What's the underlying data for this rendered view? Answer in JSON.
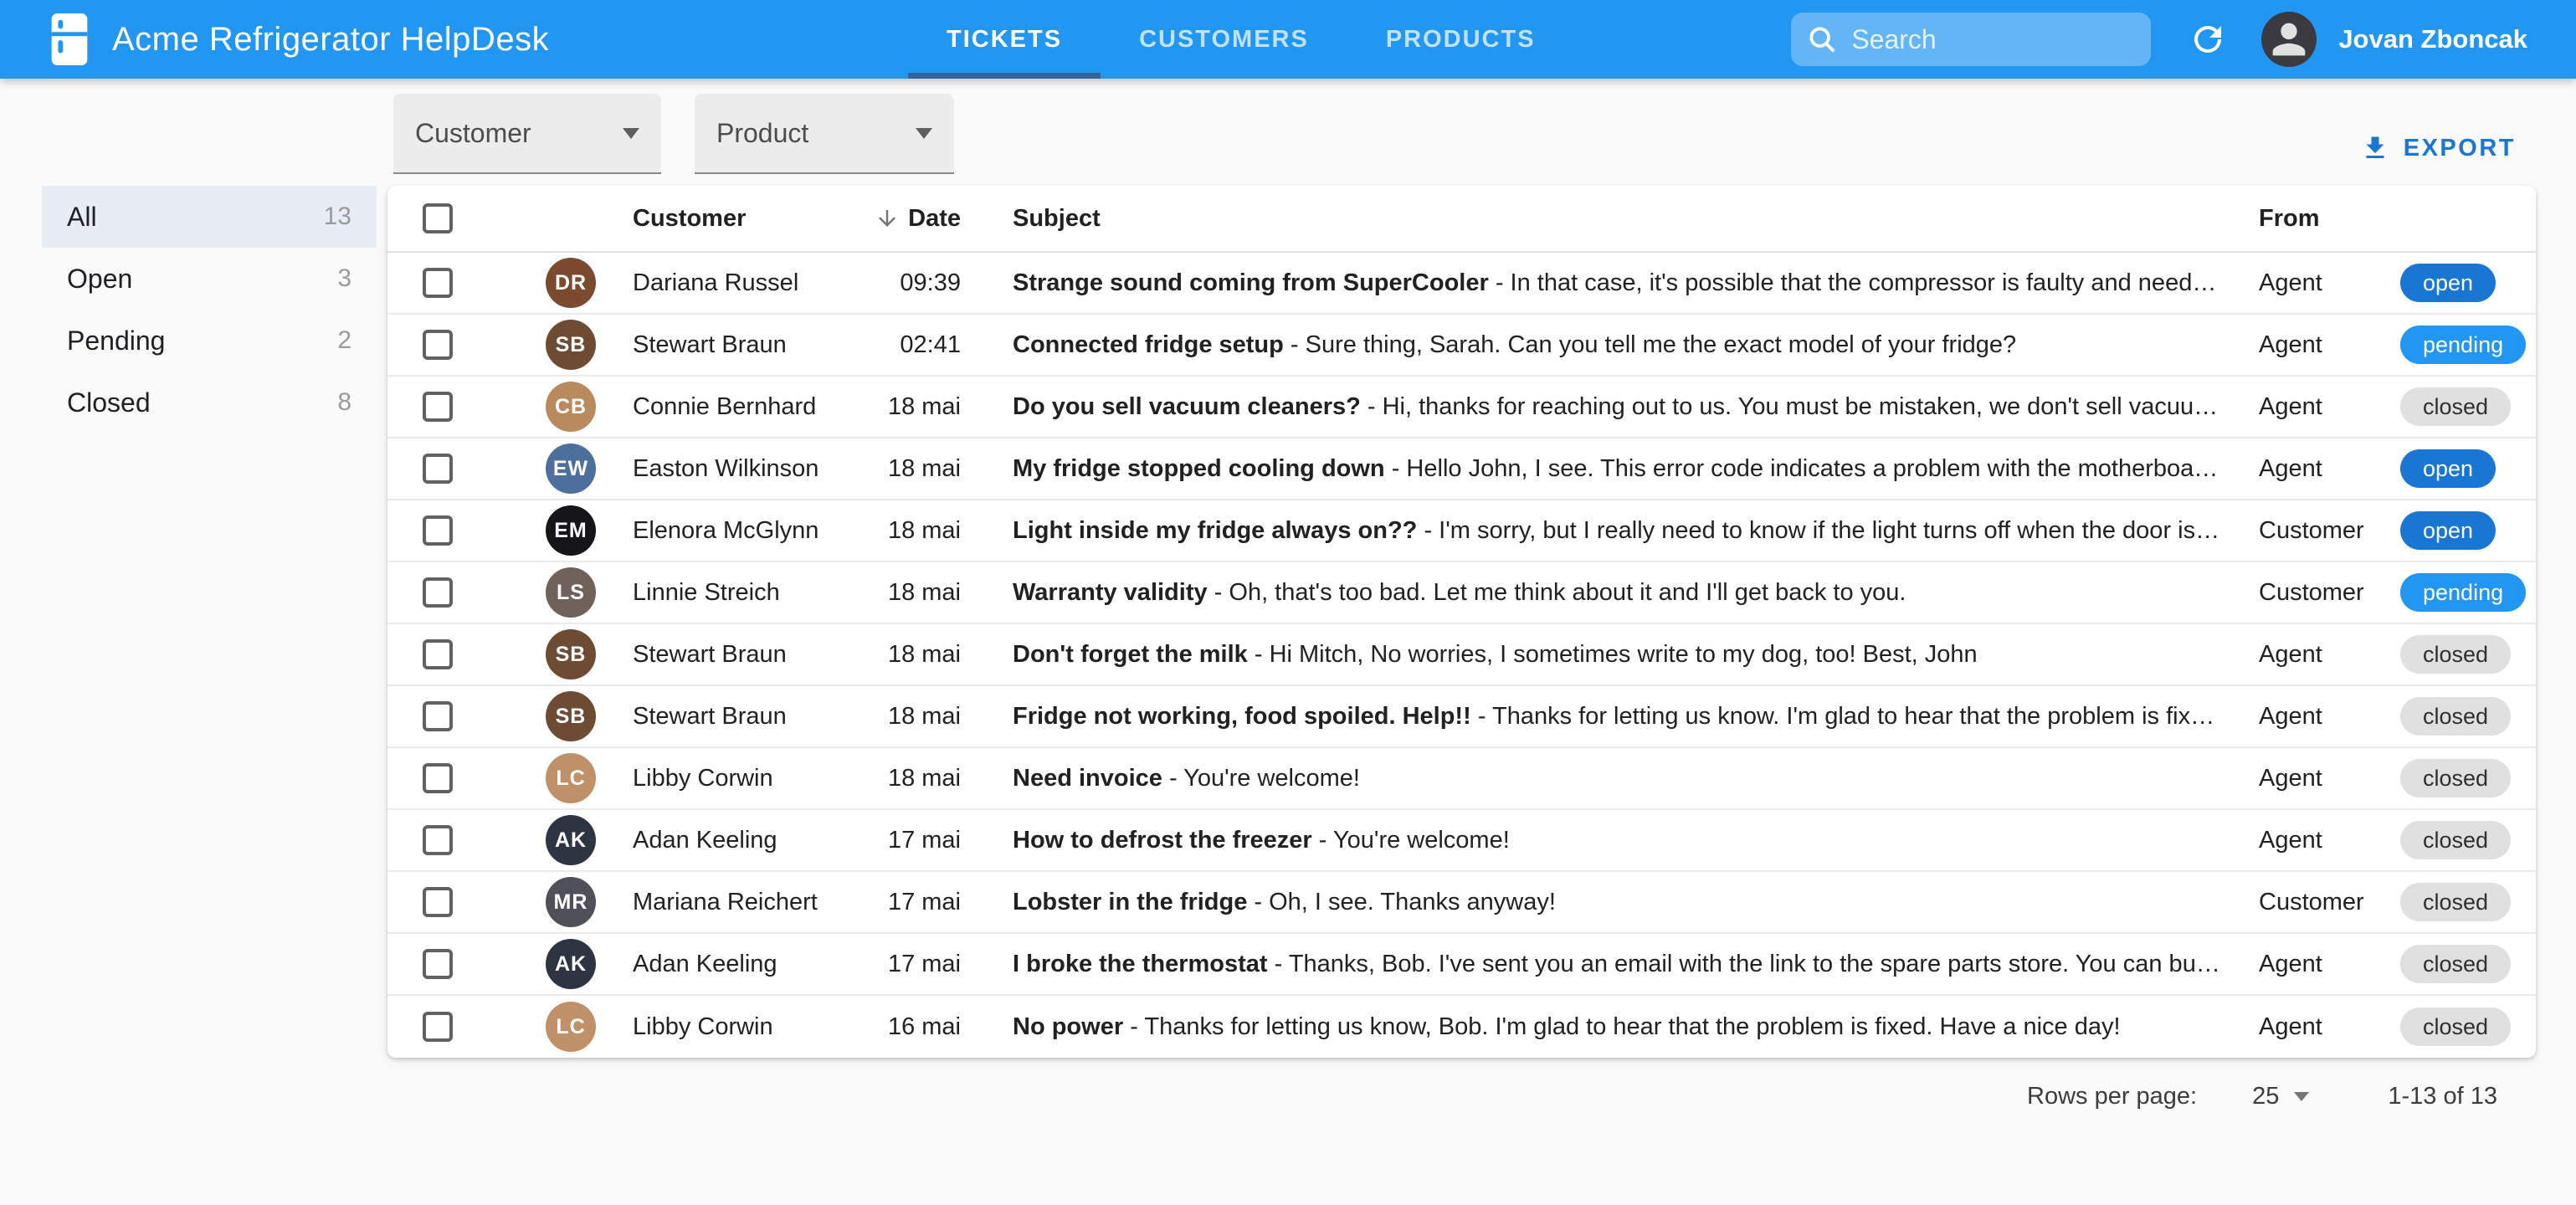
{
  "app": {
    "title": "Acme Refrigerator HelpDesk"
  },
  "nav": {
    "tabs": [
      {
        "label": "TICKETS",
        "active": true
      },
      {
        "label": "CUSTOMERS",
        "active": false
      },
      {
        "label": "PRODUCTS",
        "active": false
      }
    ]
  },
  "search": {
    "placeholder": "Search"
  },
  "user": {
    "name": "Jovan Zboncak"
  },
  "icons": {
    "logo": "fridge-icon",
    "search": "search-icon",
    "refresh": "refresh-icon",
    "export": "download-icon",
    "sort": "arrow-down-icon"
  },
  "filters": {
    "customer_label": "Customer",
    "product_label": "Product"
  },
  "export": {
    "label": "EXPORT"
  },
  "sidebar": {
    "items": [
      {
        "label": "All",
        "count": "13",
        "selected": true
      },
      {
        "label": "Open",
        "count": "3",
        "selected": false
      },
      {
        "label": "Pending",
        "count": "2",
        "selected": false
      },
      {
        "label": "Closed",
        "count": "8",
        "selected": false
      }
    ]
  },
  "table": {
    "headers": {
      "customer": "Customer",
      "date": "Date",
      "subject": "Subject",
      "from": "From"
    },
    "sort": {
      "column": "date",
      "direction": "desc"
    },
    "rows": [
      {
        "customer": "Dariana Russel",
        "avatar_color": "#7b4a2f",
        "date": "09:39",
        "subject": "Strange sound coming from SuperCooler",
        "preview": "- In that case, it's possible that the compressor is faulty and needs …",
        "from": "Agent",
        "status": "open"
      },
      {
        "customer": "Stewart Braun",
        "avatar_color": "#6e4c33",
        "date": "02:41",
        "subject": "Connected fridge setup",
        "preview": "- Sure thing, Sarah. Can you tell me the exact model of your fridge?",
        "from": "Agent",
        "status": "pending"
      },
      {
        "customer": "Connie Bernhard",
        "avatar_color": "#b98a5e",
        "date": "18 mai",
        "subject": "Do you sell vacuum cleaners?",
        "preview": "- Hi, thanks for reaching out to us. You must be mistaken, we don't sell vacuu…",
        "from": "Agent",
        "status": "closed"
      },
      {
        "customer": "Easton Wilkinson",
        "avatar_color": "#4d6f9d",
        "date": "18 mai",
        "subject": "My fridge stopped cooling down",
        "preview": "- Hello John, I see. This error code indicates a problem with the motherboar…",
        "from": "Agent",
        "status": "open"
      },
      {
        "customer": "Elenora McGlynn",
        "avatar_color": "#15151a",
        "date": "18 mai",
        "subject": "Light inside my fridge always on??",
        "preview": "- I'm sorry, but I really need to know if the light turns off when the door is …",
        "from": "Customer",
        "status": "open"
      },
      {
        "customer": "Linnie Streich",
        "avatar_color": "#70625a",
        "date": "18 mai",
        "subject": "Warranty validity",
        "preview": "- Oh, that's too bad. Let me think about it and I'll get back to you.",
        "from": "Customer",
        "status": "pending"
      },
      {
        "customer": "Stewart Braun",
        "avatar_color": "#6e4c33",
        "date": "18 mai",
        "subject": "Don't forget the milk",
        "preview": "- Hi Mitch, No worries, I sometimes write to my dog, too! Best, John",
        "from": "Agent",
        "status": "closed"
      },
      {
        "customer": "Stewart Braun",
        "avatar_color": "#6e4c33",
        "date": "18 mai",
        "subject": "Fridge not working, food spoiled. Help!!",
        "preview": "- Thanks for letting us know. I'm glad to hear that the problem is fixe…",
        "from": "Agent",
        "status": "closed"
      },
      {
        "customer": "Libby Corwin",
        "avatar_color": "#c09068",
        "date": "18 mai",
        "subject": "Need invoice",
        "preview": "- You're welcome!",
        "from": "Agent",
        "status": "closed"
      },
      {
        "customer": "Adan Keeling",
        "avatar_color": "#2d3442",
        "date": "17 mai",
        "subject": "How to defrost the freezer",
        "preview": "- You're welcome!",
        "from": "Agent",
        "status": "closed"
      },
      {
        "customer": "Mariana Reichert",
        "avatar_color": "#50505a",
        "date": "17 mai",
        "subject": "Lobster in the fridge",
        "preview": "- Oh, I see. Thanks anyway!",
        "from": "Customer",
        "status": "closed"
      },
      {
        "customer": "Adan Keeling",
        "avatar_color": "#2d3442",
        "date": "17 mai",
        "subject": "I broke the thermostat",
        "preview": "- Thanks, Bob. I've sent you an email with the link to the spare parts store. You can bu…",
        "from": "Agent",
        "status": "closed"
      },
      {
        "customer": "Libby Corwin",
        "avatar_color": "#c09068",
        "date": "16 mai",
        "subject": "No power",
        "preview": "- Thanks for letting us know, Bob. I'm glad to hear that the problem is fixed. Have a nice day!",
        "from": "Agent",
        "status": "closed"
      }
    ]
  },
  "pagination": {
    "rows_per_page_label": "Rows per page:",
    "rows_per_page": "25",
    "range": "1-13 of 13"
  },
  "colors": {
    "appbar": "#2196f3",
    "tab_indicator": "#31659c",
    "accent": "#1976d2",
    "status_open": "#1976d2",
    "status_pending": "#2196f3",
    "status_closed": "#e0e0e0",
    "status_closed_text": "#2f2f2f",
    "sidebar_selected_bg": "#e7ecf5"
  }
}
